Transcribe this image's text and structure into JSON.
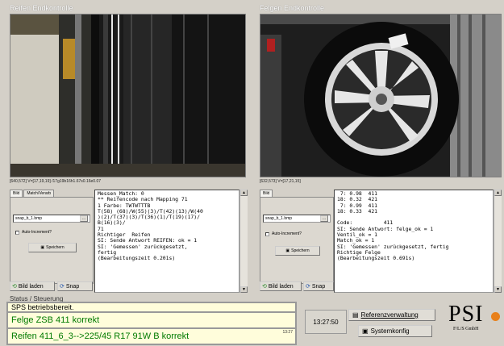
{
  "left_panel": {
    "title": "Reifen Endkontrolle",
    "coords": "[640,572] V=[17,19,19] /17g19b16h1.67s0.16e0.07",
    "tabs": [
      "Bild",
      "Match/Verarb"
    ],
    "file": "snap_b_1.bmp",
    "auto_increment": "Auto-Increment?",
    "save": "Speichern",
    "load_image": "Bild laden",
    "snap": "Snap",
    "log": [
      "Messen_Match: 0",
      "** Reifencode nach Mapping 71",
      "1 Farbe: TWTWTTTB",
      "T(58) (68)/W(55)(3)/T(42)(13)/W(40",
      ")(2)/T(37)(3)/T(36)(1)/T(19)(17)/",
      "B(16)(3)/",
      "71",
      "Richtiger  Reifen",
      "SI: Sende Antwort REIFEN: ok = 1",
      "SI: 'Gemessen' zurückgesetzt,",
      "fertig",
      "(Bearbeitungszeit 0.201s)"
    ]
  },
  "right_panel": {
    "title": "Felgen Endkontrolle",
    "coords": "[632,573] V=[17,21,15]",
    "tabs": [
      "Bild"
    ],
    "file": "snap_b_1.bmp",
    "auto_increment": "Auto-Increment?",
    "save": "Speichern",
    "load_image": "Bild laden",
    "snap": "Snap",
    "log": [
      " 7: 0.98  411",
      "18: 0.32  421",
      " 7: 0.99  411",
      "18: 0.33  421",
      "",
      "Code:          411",
      "SI: Sende Antwort: felge_ok = 1",
      "Ventil_ok = 1",
      "Match_ok = 1",
      "SI: 'Gemessen' zurückgesetzt, fertig",
      "Richtige Felge",
      "(Bearbeitungszeit 0.691s)"
    ]
  },
  "status": {
    "label": "Status / Steuerung",
    "line1": "SPS betriebsbereit.",
    "line2": "Felge ZSB 411 korrekt",
    "line3": "Reifen 411_6_3-->225/45 R17 91W B korrekt",
    "line3_time": "13:27",
    "clock": "13:27:50",
    "btn_reference": "Referenzverwaltung",
    "btn_system": "Systemkonfig"
  },
  "logo": {
    "text": "PSI",
    "subtitle": "F/L/S GmbH"
  },
  "colors": {
    "status_green": "#007a00",
    "status_bg": "#fffddb",
    "logo_accent": "#e8801a"
  }
}
